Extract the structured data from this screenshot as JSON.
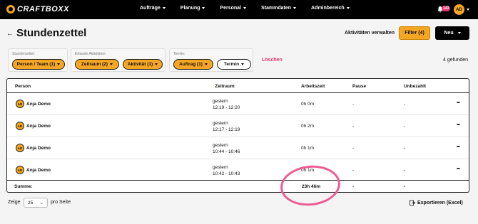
{
  "brand": {
    "name": "CRAFTBOXX",
    "accent": "#f5a623",
    "badge_color": "#e8316f"
  },
  "nav": {
    "items": [
      "Aufträge",
      "Planung",
      "Personal",
      "Stammdaten",
      "Adminbereich"
    ]
  },
  "user": {
    "initials": "AD",
    "notifications": "143"
  },
  "page": {
    "title": "Stundenzettel",
    "manage_label": "Aktivitäten verwalten",
    "filter_label": "Filter (4)",
    "new_label": "Neu"
  },
  "filters": {
    "group1": {
      "label": "Stundenzettel:",
      "chips": [
        "Person / Team (1)"
      ]
    },
    "group2": {
      "label": "Erfasste Aktivitäten:",
      "chips": [
        "Zeitraum (2)",
        "Aktivität (1)"
      ]
    },
    "group3": {
      "label": "Termin:",
      "chips": [
        "Auftrag (1)",
        "Termin"
      ]
    },
    "clear_label": "Löschen",
    "result_count": "4 gefunden"
  },
  "table": {
    "headers": {
      "person": "Person",
      "zeitraum": "Zeitraum",
      "arbeitszeit": "Arbeitszeit",
      "pause": "Pause",
      "unbezahlt": "Unbezahlt"
    },
    "rows": [
      {
        "initials": "AD",
        "name": "Anja Demo",
        "day": "gestern",
        "time": "12:19 - 12:20",
        "arbeitszeit": "0h 0m",
        "pause": "-",
        "unbezahlt": "-"
      },
      {
        "initials": "AD",
        "name": "Anja Demo",
        "day": "gestern",
        "time": "12:17 - 12:19",
        "arbeitszeit": "0h 2m",
        "pause": "-",
        "unbezahlt": "-"
      },
      {
        "initials": "AD",
        "name": "Anja Demo",
        "day": "gestern",
        "time": "10:44 - 10:46",
        "arbeitszeit": "0h 1m",
        "pause": "-",
        "unbezahlt": "-"
      },
      {
        "initials": "AD",
        "name": "Anja Demo",
        "day": "gestern",
        "time": "10:42 - 10:43",
        "arbeitszeit": "0h 1m",
        "pause": "-",
        "unbezahlt": "-"
      }
    ],
    "summary": {
      "label": "Summe:",
      "arbeitszeit": "23h 46m",
      "pause": "-",
      "unbezahlt": "-"
    }
  },
  "footer": {
    "show_label": "Zeige",
    "page_size": "25",
    "per_page_label": "pro Seite",
    "export_label": "Exportieren (Excel)"
  },
  "annotation": {
    "color": "#ec5c93"
  }
}
